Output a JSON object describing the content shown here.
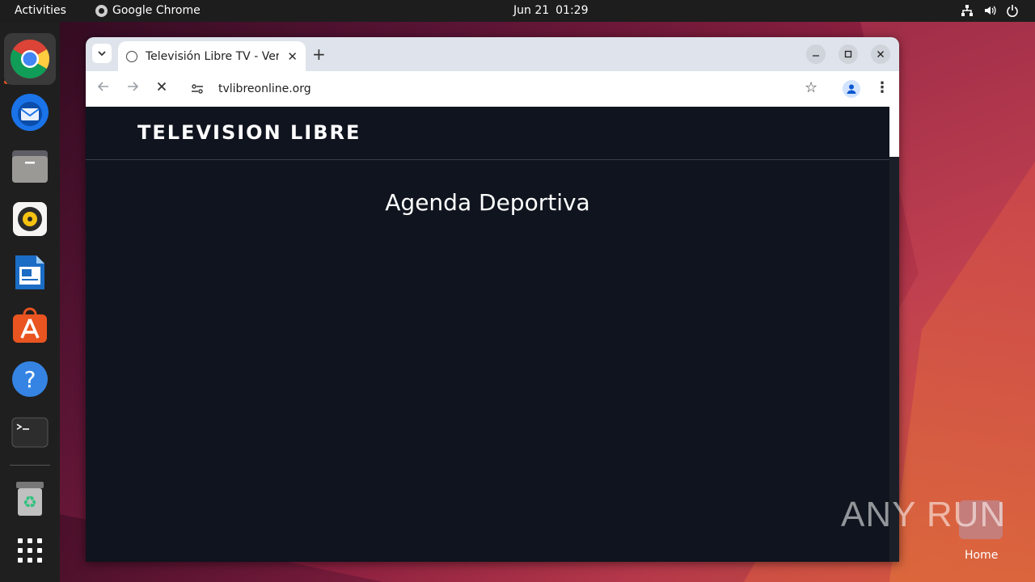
{
  "topbar": {
    "activities": "Activities",
    "app_name": "Google Chrome",
    "date": "Jun 21",
    "time": "01:29"
  },
  "dock": {
    "items": [
      "chrome-icon",
      "thunderbird-icon",
      "files-icon",
      "rhythmbox-icon",
      "libreoffice-writer-icon",
      "app-center-icon",
      "help-icon",
      "terminal-icon",
      "trash-icon",
      "app-grid-icon"
    ]
  },
  "browser": {
    "tab_title": "Televisión Libre TV - Ver",
    "url": "tvlibreonline.org"
  },
  "page": {
    "site_title": "TELEVISION LIBRE",
    "heading": "Agenda Deportiva"
  },
  "desktop": {
    "watermark": "ANY RUN",
    "home_label": "Home"
  },
  "colors": {
    "ubuntu_orange": "#e95420",
    "page_bg": "#0f141e"
  }
}
